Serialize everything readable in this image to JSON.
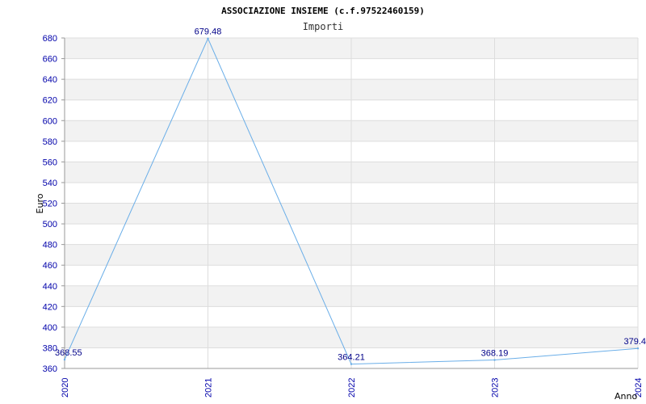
{
  "chart_data": {
    "type": "line",
    "title": "ASSOCIAZIONE INSIEME (c.f.97522460159)",
    "subtitle": "Importi",
    "xlabel": "Anno",
    "ylabel": "Euro",
    "categories": [
      "2020",
      "2021",
      "2022",
      "2023",
      "2024"
    ],
    "series": [
      {
        "values": [
          368.55,
          679.48,
          364.21,
          368.19,
          379.4
        ],
        "labels": [
          "368.55",
          "679.48",
          "364.21",
          "368.19",
          "379.4"
        ]
      }
    ],
    "ylim": [
      360,
      680
    ],
    "yticks": [
      360,
      380,
      400,
      420,
      440,
      460,
      480,
      500,
      520,
      540,
      560,
      580,
      600,
      620,
      640,
      660,
      680
    ],
    "grid": true,
    "colors": {
      "line": "#6aaee8",
      "band_alt": "#f2f2f2",
      "grid": "#dddddd",
      "ticks": "#0000aa",
      "data_labels": "#000088"
    }
  }
}
